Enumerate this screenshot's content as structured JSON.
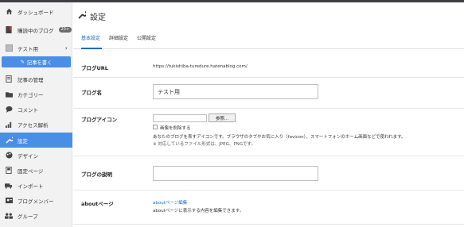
{
  "sidebar": {
    "items": [
      {
        "icon": "home-icon",
        "label": "ダッシュボード"
      },
      {
        "icon": "bookmark-icon",
        "label": "購読中のブログ",
        "badge": "20+"
      },
      {
        "icon": "blog-icon",
        "label": "テスト用"
      },
      {
        "icon": "doc-icon",
        "label": "記事の管理"
      },
      {
        "icon": "folder-icon",
        "label": "カテゴリー"
      },
      {
        "icon": "comment-icon",
        "label": "コメント"
      },
      {
        "icon": "chart-icon",
        "label": "アクセス解析"
      },
      {
        "icon": "wrench-icon",
        "label": "設定"
      },
      {
        "icon": "palette-icon",
        "label": "デザイン"
      },
      {
        "icon": "page-icon",
        "label": "固定ページ"
      },
      {
        "icon": "truck-icon",
        "label": "インポート"
      },
      {
        "icon": "member-icon",
        "label": "ブログメンバー"
      },
      {
        "icon": "group-icon",
        "label": "グループ"
      }
    ],
    "write_button": "記事を書く"
  },
  "main": {
    "title": "設定",
    "tabs": [
      "基本設定",
      "詳細設定",
      "公開設定"
    ],
    "rows": {
      "url_label": "ブログURL",
      "url_value": "https://tukishiba-turedure.hatenablog.com/",
      "name_label": "ブログ名",
      "name_value": "テスト用",
      "icon_label": "ブログアイコン",
      "browse_label": "参照...",
      "delete_label": "画像を削除する",
      "icon_help1": "あなたのブログを表すアイコンです。ブラウザのタブやお気に入り（favicon）、スマートフォンのホーム画面などで使われます。",
      "icon_help2": "※ 対応しているファイル形式は、JPEG、PNGです。",
      "desc_label": "ブログの説明",
      "about_label": "aboutページ",
      "about_link": "aboutページ編集",
      "about_help": "aboutページに表示する内容を編集できます。"
    }
  },
  "colors": {
    "accent": "#4a8ee6",
    "link": "#1b6ac9"
  }
}
